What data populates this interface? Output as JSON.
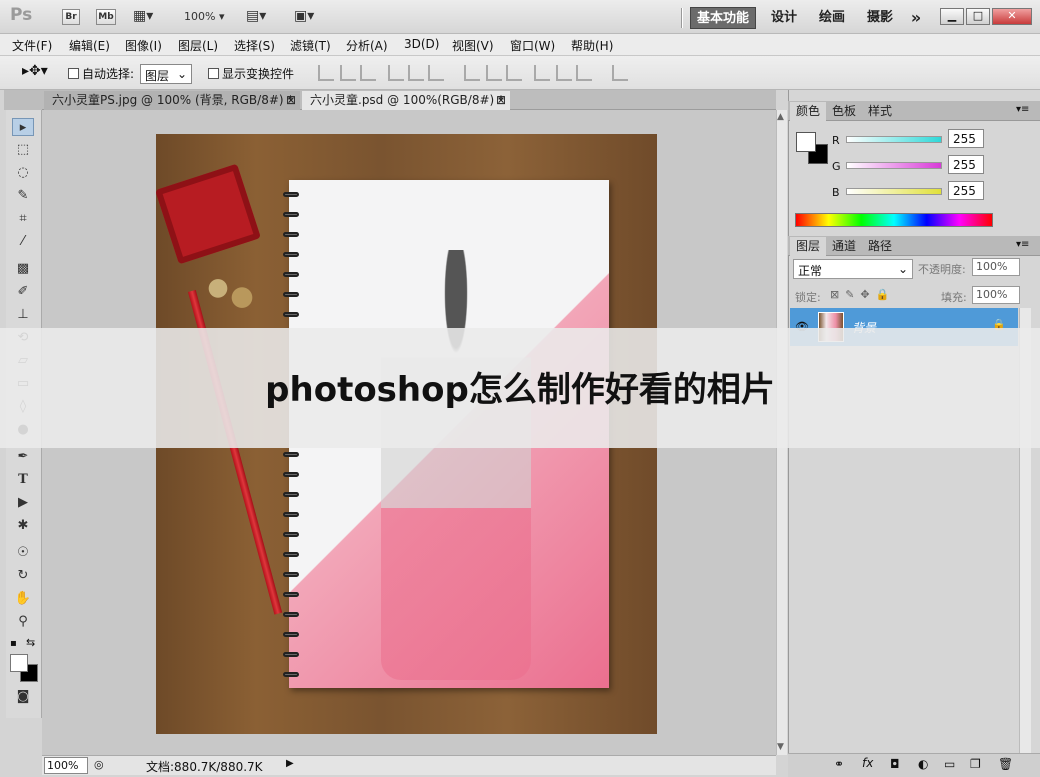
{
  "app": {
    "logo": "Ps",
    "bridge_label": "Br",
    "minibridge_label": "Mb",
    "zoom_dropdown": "100%",
    "workspaces": [
      "基本功能",
      "设计",
      "绘画",
      "摄影"
    ],
    "more_workspaces": "»"
  },
  "menu": [
    "文件(F)",
    "编辑(E)",
    "图像(I)",
    "图层(L)",
    "选择(S)",
    "滤镜(T)",
    "分析(A)",
    "3D(D)",
    "视图(V)",
    "窗口(W)",
    "帮助(H)"
  ],
  "options": {
    "auto_select_label": "自动选择:",
    "auto_select_value": "图层",
    "show_transform_label": "显示变换控件"
  },
  "tabs": [
    {
      "label": "六小灵童PS.jpg @ 100% (背景, RGB/8#) *",
      "active": false
    },
    {
      "label": "六小灵童.psd @ 100%(RGB/8#) *",
      "active": true
    }
  ],
  "status": {
    "zoom": "100%",
    "doc_size": "文档:880.7K/880.7K"
  },
  "color_panel": {
    "tabs": [
      "颜色",
      "色板",
      "样式"
    ],
    "channels": [
      {
        "label": "R",
        "value": "255",
        "color": "#2fd8d8"
      },
      {
        "label": "G",
        "value": "255",
        "color": "#d83ad8"
      },
      {
        "label": "B",
        "value": "255",
        "color": "#e0e03a"
      }
    ]
  },
  "layers_panel": {
    "tabs": [
      "图层",
      "通道",
      "路径"
    ],
    "blend_mode": "正常",
    "opacity_label": "不透明度:",
    "opacity_value": "100%",
    "lock_label": "锁定:",
    "fill_label": "填充:",
    "fill_value": "100%",
    "layer_name": "背景"
  },
  "banner": {
    "title": "photoshop怎么制作好看的相片"
  },
  "colors": {
    "accent": "#4f9ad8",
    "workspace_active_bg": "#6b6b6b"
  }
}
